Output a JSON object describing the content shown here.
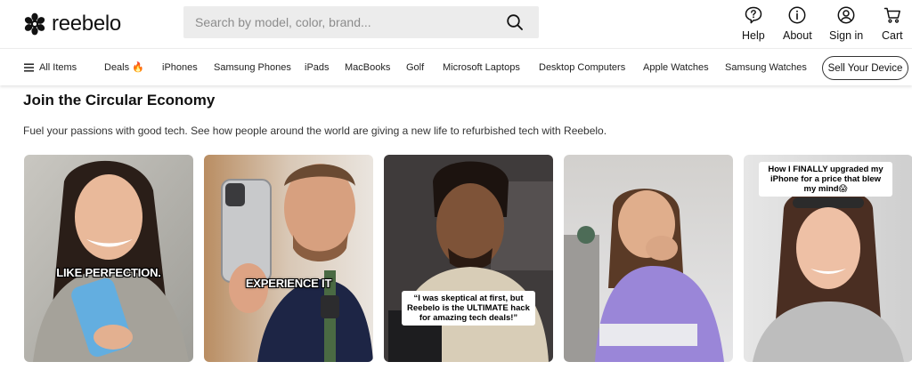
{
  "header": {
    "logo_text": "reebelo",
    "search": {
      "placeholder": "Search by model, color, brand..."
    },
    "actions": [
      {
        "label": "Help",
        "icon": "help-chat-icon"
      },
      {
        "label": "About",
        "icon": "info-icon"
      },
      {
        "label": "Sign in",
        "icon": "user-icon"
      },
      {
        "label": "Cart",
        "icon": "cart-icon"
      }
    ]
  },
  "nav": {
    "all_items": "All Items",
    "items": [
      "Deals 🔥",
      "iPhones",
      "Samsung Phones",
      "iPads",
      "MacBooks",
      "Golf",
      "Microsoft Laptops",
      "Desktop Computers",
      "Apple Watches",
      "Samsung Watches"
    ],
    "sell_button": "Sell Your Device"
  },
  "section": {
    "title": "Join the Circular Economy",
    "description": "Fuel your passions with good tech. See how people around the world are giving a new life to refurbished tech with Reebelo."
  },
  "videos": [
    {
      "caption": "LIKE PERFECTION."
    },
    {
      "caption": "EXPERIENCE IT"
    },
    {
      "caption": "“I was skeptical at first, but Reebelo is the ULTIMATE hack for amazing tech deals!”"
    },
    {
      "caption": ""
    },
    {
      "caption": "How I FINALLY upgraded my iPhone for a price that blew my mind😱"
    }
  ],
  "colors": {
    "text": "#111111",
    "search_bg": "#ececec",
    "nav_border": "#ececec"
  }
}
